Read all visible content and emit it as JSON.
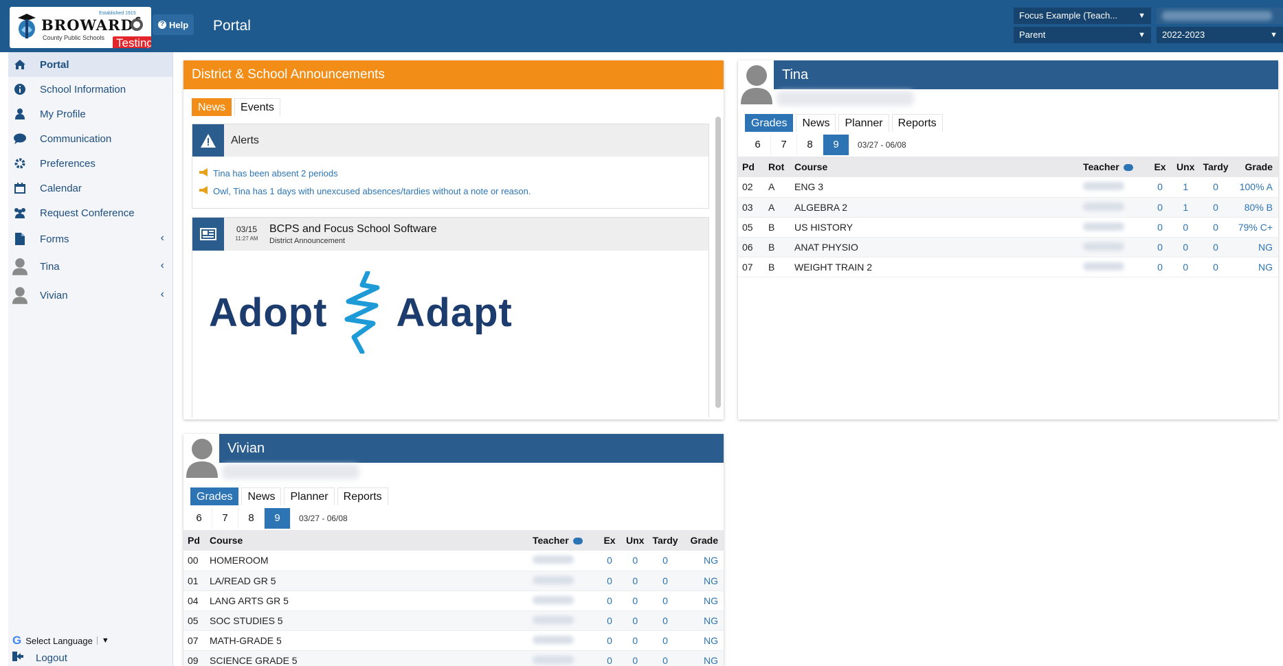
{
  "header": {
    "logo_name": "BROWARD",
    "logo_sub": "County Public Schools",
    "logo_est": "Established 1915",
    "testing_badge": "Testing",
    "help_label": "Help",
    "title": "Portal",
    "school_select": "Focus Example (Teach...",
    "role_select": "Parent",
    "year_select": "2022-2023",
    "colors": {
      "header_bg": "#1f5a8f",
      "badge": "#e3262c"
    }
  },
  "sidebar": {
    "items": [
      {
        "label": "Portal",
        "icon": "home-icon"
      },
      {
        "label": "School Information",
        "icon": "info-icon"
      },
      {
        "label": "My Profile",
        "icon": "person-icon"
      },
      {
        "label": "Communication",
        "icon": "chat-bubble-icon"
      },
      {
        "label": "Preferences",
        "icon": "gear-icon"
      },
      {
        "label": "Calendar",
        "icon": "calendar-icon"
      },
      {
        "label": "Request Conference",
        "icon": "group-icon"
      },
      {
        "label": "Forms",
        "icon": "document-icon"
      },
      {
        "label": "Tina",
        "icon": "avatar-icon"
      },
      {
        "label": "Vivian",
        "icon": "avatar-icon"
      }
    ],
    "language_label": "Select Language",
    "logout_label": "Logout"
  },
  "announcements": {
    "title": "District & School Announcements",
    "tabs": [
      "News",
      "Events"
    ],
    "alerts_title": "Alerts",
    "alerts": [
      "Tina has been absent 2 periods",
      "Owl, Tina has 1 days with unexcused absences/tardies without a note or reason."
    ],
    "news_item": {
      "date": "03/15",
      "time": "11:27 AM",
      "title": "BCPS and Focus School Software",
      "subtitle": "District Announcement",
      "image_words": [
        "Adopt",
        "Adapt"
      ]
    },
    "color": "#f28d17"
  },
  "tina": {
    "name": "Tina",
    "tabs": [
      "Grades",
      "News",
      "Planner",
      "Reports"
    ],
    "marking_periods": [
      "6",
      "7",
      "8",
      "9"
    ],
    "range": "03/27 - 06/08",
    "columns": [
      "Pd",
      "Rot",
      "Course",
      "Teacher",
      "Ex",
      "Unx",
      "Tardy",
      "Grade"
    ],
    "rows": [
      {
        "pd": "02",
        "rot": "A",
        "course": "ENG 3",
        "ex": "0",
        "unx": "1",
        "tardy": "0",
        "grade": "100% A"
      },
      {
        "pd": "03",
        "rot": "A",
        "course": "ALGEBRA 2",
        "ex": "0",
        "unx": "1",
        "tardy": "0",
        "grade": "80% B"
      },
      {
        "pd": "05",
        "rot": "B",
        "course": "US HISTORY",
        "ex": "0",
        "unx": "0",
        "tardy": "0",
        "grade": "79% C+"
      },
      {
        "pd": "06",
        "rot": "B",
        "course": "ANAT PHYSIO",
        "ex": "0",
        "unx": "0",
        "tardy": "0",
        "grade": "NG"
      },
      {
        "pd": "07",
        "rot": "B",
        "course": "WEIGHT TRAIN 2",
        "ex": "0",
        "unx": "0",
        "tardy": "0",
        "grade": "NG"
      }
    ]
  },
  "vivian": {
    "name": "Vivian",
    "tabs": [
      "Grades",
      "News",
      "Planner",
      "Reports"
    ],
    "marking_periods": [
      "6",
      "7",
      "8",
      "9"
    ],
    "range": "03/27 - 06/08",
    "columns": [
      "Pd",
      "Course",
      "Teacher",
      "Ex",
      "Unx",
      "Tardy",
      "Grade"
    ],
    "rows": [
      {
        "pd": "00",
        "course": "HOMEROOM",
        "ex": "0",
        "unx": "0",
        "tardy": "0",
        "grade": "NG"
      },
      {
        "pd": "01",
        "course": "LA/READ GR 5",
        "ex": "0",
        "unx": "0",
        "tardy": "0",
        "grade": "NG"
      },
      {
        "pd": "04",
        "course": "LANG ARTS GR 5",
        "ex": "0",
        "unx": "0",
        "tardy": "0",
        "grade": "NG"
      },
      {
        "pd": "05",
        "course": "SOC STUDIES 5",
        "ex": "0",
        "unx": "0",
        "tardy": "0",
        "grade": "NG"
      },
      {
        "pd": "07",
        "course": "MATH-GRADE 5",
        "ex": "0",
        "unx": "0",
        "tardy": "0",
        "grade": "NG"
      },
      {
        "pd": "09",
        "course": "SCIENCE GRADE 5",
        "ex": "0",
        "unx": "0",
        "tardy": "0",
        "grade": "NG"
      }
    ]
  }
}
